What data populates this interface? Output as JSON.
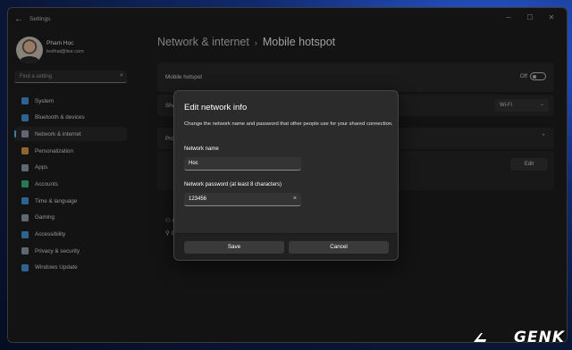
{
  "window": {
    "app_title": "Settings",
    "back_glyph": "←",
    "controls": {
      "minimize": "─",
      "maximize": "☐",
      "close": "✕"
    }
  },
  "user": {
    "name": "Pham Học",
    "email": "lexthai@live.com"
  },
  "search": {
    "placeholder": "Find a setting",
    "icon": "search-icon"
  },
  "sidebar": {
    "items": [
      {
        "label": "System",
        "icon": "system-icon",
        "color": "#4c9ee8"
      },
      {
        "label": "Bluetooth & devices",
        "icon": "bluetooth-icon",
        "color": "#4c9ee8"
      },
      {
        "label": "Network & internet",
        "icon": "network-icon",
        "color": "#9aa6b8",
        "active": true
      },
      {
        "label": "Personalization",
        "icon": "brush-icon",
        "color": "#e8a04c"
      },
      {
        "label": "Apps",
        "icon": "apps-icon",
        "color": "#9aa6b8"
      },
      {
        "label": "Accounts",
        "icon": "accounts-icon",
        "color": "#3cc48a"
      },
      {
        "label": "Time & language",
        "icon": "clock-globe-icon",
        "color": "#4c9ee8"
      },
      {
        "label": "Gaming",
        "icon": "gaming-icon",
        "color": "#9aa6b8"
      },
      {
        "label": "Accessibility",
        "icon": "accessibility-icon",
        "color": "#4c9ee8"
      },
      {
        "label": "Privacy & security",
        "icon": "shield-icon",
        "color": "#9aa6b8"
      },
      {
        "label": "Windows Update",
        "icon": "update-icon",
        "color": "#4c9ee8"
      }
    ]
  },
  "breadcrumb": {
    "parent": "Network & internet",
    "separator": "›",
    "current": "Mobile hotspot"
  },
  "settings": {
    "mobile_hotspot": {
      "label": "Mobile hotspot",
      "state": "Off"
    },
    "share_row": {
      "label_prefix": "Sha",
      "select_value": "Wi-Fi"
    },
    "properties_row": {
      "label_prefix": "Pro"
    },
    "edit_button": "Edit",
    "links": [
      "G",
      "G"
    ]
  },
  "dialog": {
    "title": "Edit network info",
    "description": "Change the network name and password that other people use for your shared connection.",
    "name_label": "Network name",
    "name_value": "Hoc",
    "password_label": "Network password (at least 8 characters)",
    "password_value": "123456",
    "save": "Save",
    "cancel": "Cancel"
  },
  "watermark": {
    "text": "GENK"
  },
  "colors": {
    "accent": "#60cdff",
    "window_bg": "#202020",
    "card_bg": "#2b2b2b"
  }
}
